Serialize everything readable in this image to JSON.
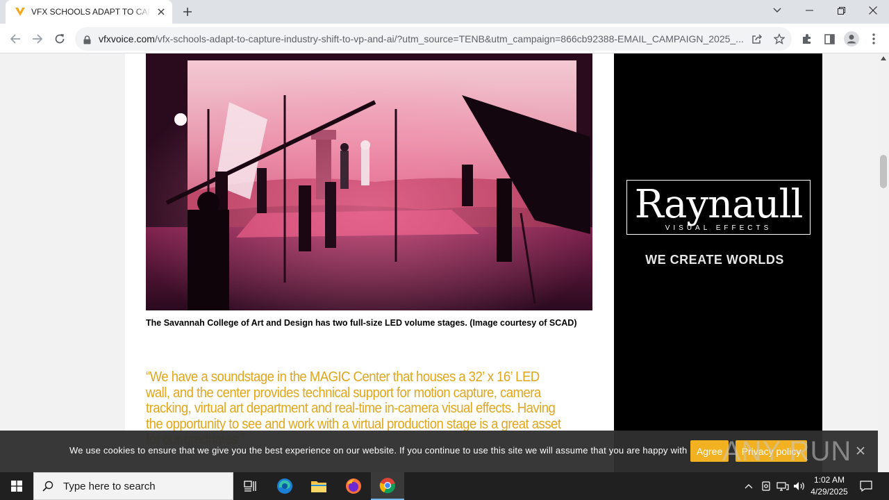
{
  "browser": {
    "tab": {
      "title": "VFX SCHOOLS ADAPT TO CAPTU"
    },
    "url": {
      "host": "vfxvoice.com",
      "path": "/vfx-schools-adapt-to-capture-industry-shift-to-vp-and-ai/?utm_source=TENB&utm_campaign=866cb92388-EMAIL_CAMPAIGN_2025_..."
    }
  },
  "article": {
    "image_alt": "Film crew on an LED volume stage with astronauts on a red planet set",
    "caption": "The Savannah College of Art and Design has two full-size LED volume stages. (Image courtesy of SCAD)",
    "quote": "“We have a soundstage in the MAGIC Center that houses a 32’ x 16’ LED wall, and the center provides technical support for motion capture, camera tracking, virtual art department and real-time in-camera visual effects. Having the opportunity to see and work with a virtual production stage is a great asset for our graduates.”"
  },
  "ad": {
    "brand": "Raynaull",
    "subtitle": "VISUAL EFFECTS",
    "tagline": "WE CREATE WORLDS"
  },
  "cookie_banner": {
    "text": "We use cookies to ensure that we give you the best experience on our website. If you continue to use this site we will assume that you are happy with it.",
    "agree_label": "Agree",
    "privacy_label": "Privacy policy",
    "watermark": "ANY RUN"
  },
  "taskbar": {
    "search_placeholder": "Type here to search",
    "time": "1:02 AM",
    "date": "4/29/2025"
  },
  "colors": {
    "accent_quote": "#e0a61c",
    "cookie_button": "#f2b120",
    "tab_strip": "#dee1e6"
  }
}
